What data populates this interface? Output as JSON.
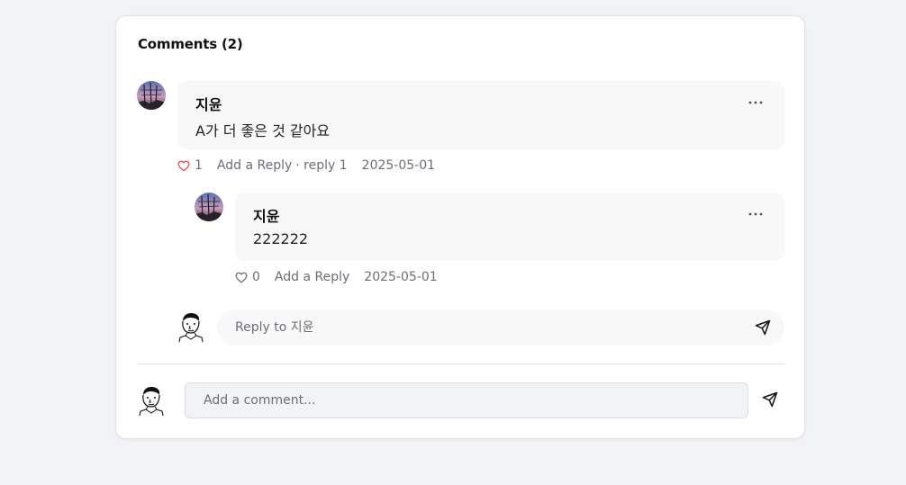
{
  "section": {
    "title": "Comments (2)"
  },
  "comment": {
    "author": "지윤",
    "text": "A가 더 좋은 것 같아요",
    "likes": "1",
    "add_reply": "Add a Reply",
    "reply_count": "· reply 1",
    "date": "2025-05-01",
    "liked": true
  },
  "reply": {
    "author": "지윤",
    "text": "222222",
    "likes": "0",
    "add_reply": "Add a Reply",
    "date": "2025-05-01",
    "liked": false
  },
  "reply_box": {
    "placeholder": "Reply to 지윤"
  },
  "comment_box": {
    "placeholder": "Add a comment..."
  },
  "colors": {
    "like_active": "#e5484d",
    "muted": "#6b6f76",
    "bubble_bg": "#f8f8f9"
  },
  "icons": {
    "more": "more-horizontal-icon",
    "like": "heart-icon",
    "send": "send-icon"
  }
}
